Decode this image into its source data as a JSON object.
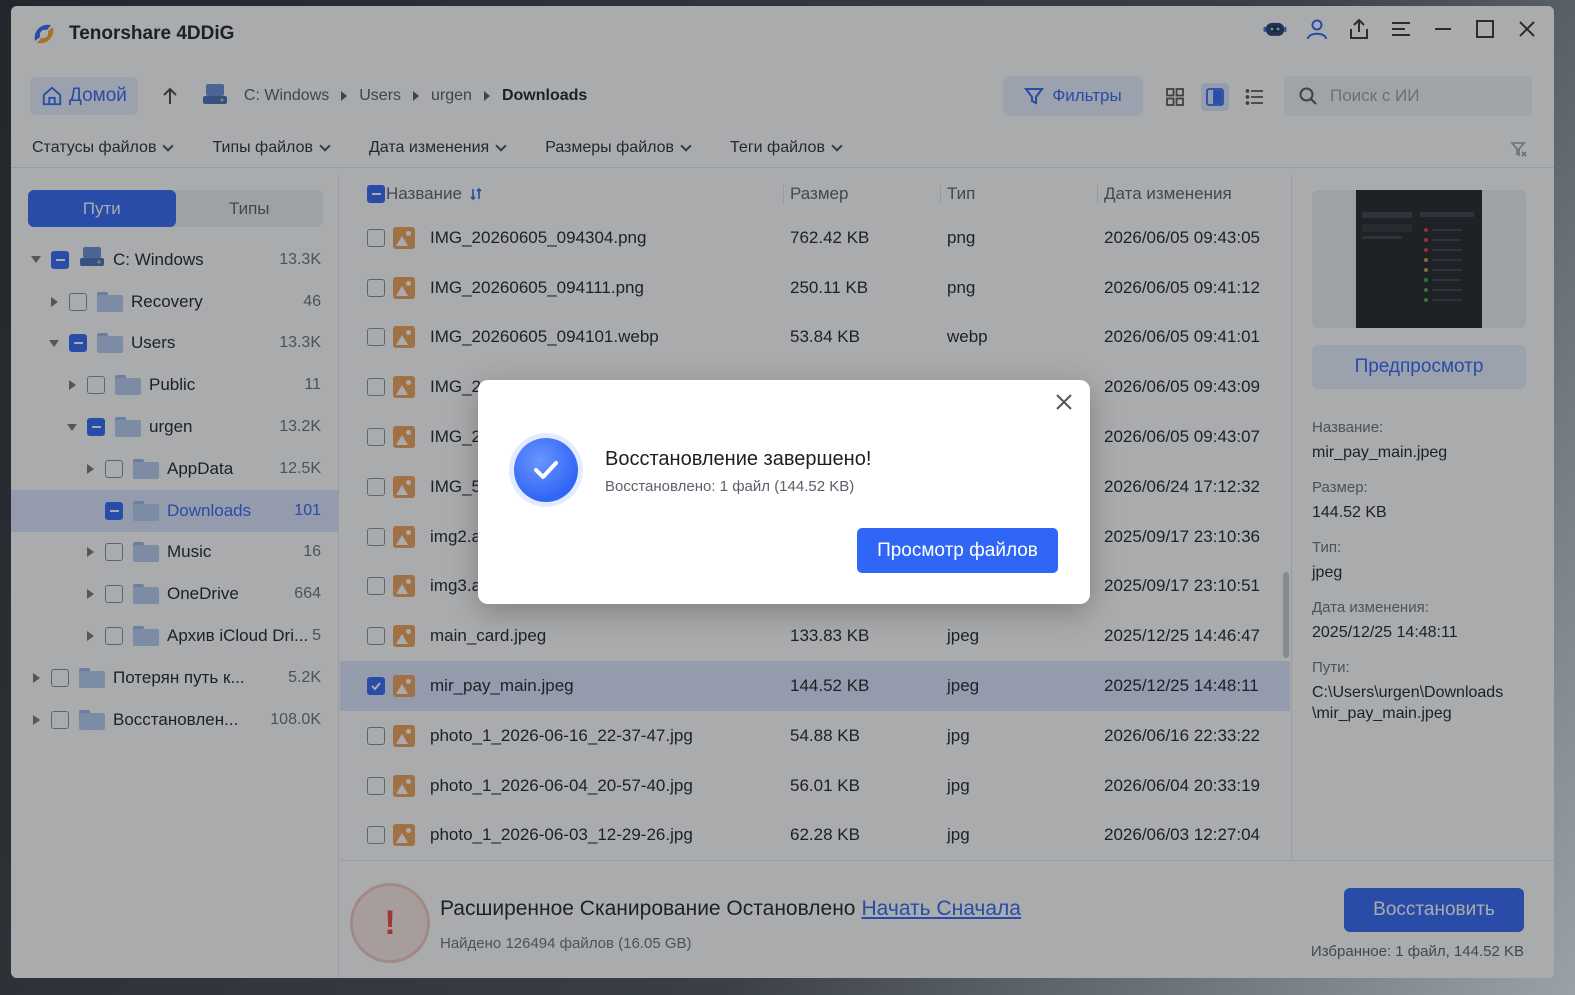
{
  "app": {
    "title": "Tenorshare 4DDiG"
  },
  "colors": {
    "accent": "#2f66f5",
    "selection": "#dce6ff",
    "warning": "#e8453c"
  },
  "nav": {
    "home_label": "Домой",
    "breadcrumbs": [
      "C: Windows",
      "Users",
      "urgen",
      "Downloads"
    ],
    "filters_label": "Фильтры",
    "search_placeholder": "Поиск с ИИ"
  },
  "filter_dropdowns": [
    "Статусы файлов",
    "Типы файлов",
    "Дата изменения",
    "Размеры файлов",
    "Теги файлов"
  ],
  "sidebar": {
    "tabs": [
      "Пути",
      "Типы"
    ],
    "active_tab": "Пути",
    "tree": [
      {
        "label": "C: Windows",
        "count": "13.3K",
        "level": 0,
        "expanded": true,
        "check": "partial",
        "icon": "drive-icon"
      },
      {
        "label": "Recovery",
        "count": "46",
        "level": 1,
        "expanded": false,
        "check": "none",
        "icon": "folder-icon"
      },
      {
        "label": "Users",
        "count": "13.3K",
        "level": 1,
        "expanded": true,
        "check": "partial",
        "icon": "folder-icon"
      },
      {
        "label": "Public",
        "count": "11",
        "level": 2,
        "expanded": false,
        "check": "none",
        "icon": "folder-icon"
      },
      {
        "label": "urgen",
        "count": "13.2K",
        "level": 2,
        "expanded": true,
        "check": "partial",
        "icon": "folder-icon"
      },
      {
        "label": "AppData",
        "count": "12.5K",
        "level": 3,
        "expanded": false,
        "check": "none",
        "icon": "folder-icon"
      },
      {
        "label": "Downloads",
        "count": "101",
        "level": 3,
        "leaf": true,
        "check": "partial",
        "icon": "folder-icon",
        "selected": true
      },
      {
        "label": "Music",
        "count": "16",
        "level": 3,
        "expanded": false,
        "check": "none",
        "icon": "folder-icon"
      },
      {
        "label": "OneDrive",
        "count": "664",
        "level": 3,
        "expanded": false,
        "check": "none",
        "icon": "folder-icon"
      },
      {
        "label": "Архив iCloud Dri...",
        "count": "5",
        "level": 3,
        "expanded": false,
        "check": "none",
        "icon": "folder-icon"
      },
      {
        "label": "Потерян путь к...",
        "count": "5.2K",
        "level": 0,
        "expanded": false,
        "check": "none",
        "icon": "lost-path-icon"
      },
      {
        "label": "Восстановлен...",
        "count": "108.0K",
        "level": 0,
        "expanded": false,
        "check": "none",
        "icon": "recovered-icon"
      }
    ]
  },
  "file_list": {
    "columns": [
      "Название",
      "Размер",
      "Тип",
      "Дата изменения"
    ],
    "rows": [
      {
        "name": "IMG_20260605_094304.png",
        "size": "762.42 KB",
        "type": "png",
        "date": "2026/06/05 09:43:05",
        "checked": false
      },
      {
        "name": "IMG_20260605_094111.png",
        "size": "250.11 KB",
        "type": "png",
        "date": "2026/06/05 09:41:12",
        "checked": false
      },
      {
        "name": "IMG_20260605_094101.webp",
        "size": "53.84 KB",
        "type": "webp",
        "date": "2026/06/05 09:41:01",
        "checked": false
      },
      {
        "name": "IMG_2",
        "size": "",
        "type": "",
        "date": "2026/06/05 09:43:09",
        "checked": false
      },
      {
        "name": "IMG_2",
        "size": "",
        "type": "",
        "date": "2026/06/05 09:43:07",
        "checked": false
      },
      {
        "name": "IMG_5",
        "size": "",
        "type": "",
        "date": "2026/06/24 17:12:32",
        "checked": false
      },
      {
        "name": "img2.a",
        "size": "",
        "type": "",
        "date": "2025/09/17 23:10:36",
        "checked": false
      },
      {
        "name": "img3.a",
        "size": "",
        "type": "",
        "date": "2025/09/17 23:10:51",
        "checked": false
      },
      {
        "name": "main_card.jpeg",
        "size": "133.83 KB",
        "type": "jpeg",
        "date": "2025/12/25 14:46:47",
        "checked": false
      },
      {
        "name": "mir_pay_main.jpeg",
        "size": "144.52 KB",
        "type": "jpeg",
        "date": "2025/12/25 14:48:11",
        "checked": true
      },
      {
        "name": "photo_1_2026-06-16_22-37-47.jpg",
        "size": "54.88 KB",
        "type": "jpg",
        "date": "2026/06/16 22:33:22",
        "checked": false
      },
      {
        "name": "photo_1_2026-06-04_20-57-40.jpg",
        "size": "56.01 KB",
        "type": "jpg",
        "date": "2026/06/04 20:33:19",
        "checked": false
      },
      {
        "name": "photo_1_2026-06-03_12-29-26.jpg",
        "size": "62.28 KB",
        "type": "jpg",
        "date": "2026/06/03 12:27:04",
        "checked": false
      }
    ]
  },
  "details": {
    "preview_label": "Предпросмотр",
    "name_label": "Название:",
    "name": "mir_pay_main.jpeg",
    "size_label": "Размер:",
    "size": "144.52 KB",
    "type_label": "Тип:",
    "type": "jpeg",
    "date_label": "Дата изменения:",
    "date": "2025/12/25 14:48:11",
    "path_label": "Пути:",
    "path": "C:\\Users\\urgen\\Downloads\\mir_pay_main.jpeg"
  },
  "bottom": {
    "scan_status": "Расширенное Сканирование Остановлено",
    "restart_link": "Начать Сначала",
    "found": "Найдено 126494 файлов (16.05 GB)",
    "recover_label": "Восстановить",
    "favorites": "Избранное: 1 файл, 144.52 KB"
  },
  "dialog": {
    "title": "Восстановление завершено!",
    "subtitle": "Восстановлено: 1 файл (144.52 KB)",
    "button": "Просмотр файлов"
  }
}
